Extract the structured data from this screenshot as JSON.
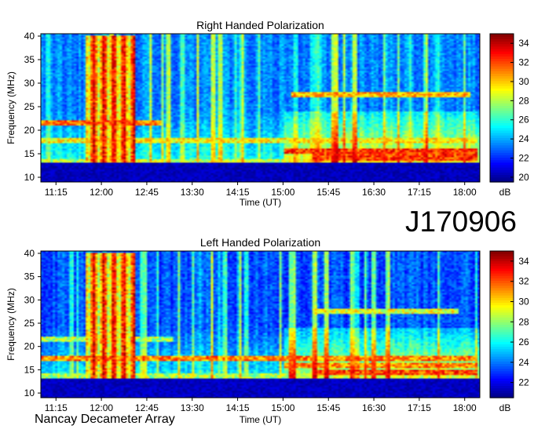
{
  "figure": {
    "date_id": "J170906",
    "instrument": "Nancay Decameter Array"
  },
  "chart_data": [
    {
      "type": "heatmap",
      "title": "Right Handed Polarization",
      "xlabel": "Time (UT)",
      "ylabel": "Frequency (MHz)",
      "xticks": [
        "11:15",
        "12:00",
        "12:45",
        "13:30",
        "14:15",
        "15:00",
        "15:45",
        "16:30",
        "17:15",
        "18:00"
      ],
      "xlim_hours": [
        11.0,
        18.25
      ],
      "yticks": [
        10,
        15,
        20,
        25,
        30,
        35,
        40
      ],
      "ylim": [
        9,
        40.5
      ],
      "colorbar": {
        "label": "dB",
        "ticks": [
          20,
          22,
          24,
          26,
          28,
          30,
          32,
          34
        ],
        "range": [
          19.5,
          35
        ],
        "colormap": "jet"
      },
      "features": {
        "bursts": [
          {
            "t0": 11.75,
            "t1": 12.55,
            "f0": 13,
            "f1": 40,
            "level": 35
          }
        ],
        "bands": [
          {
            "f": 27.5,
            "t0": 15.15,
            "t1": 18.1,
            "level": 32
          },
          {
            "f": 21.5,
            "t0": 11.0,
            "t1": 13.0,
            "level": 33
          },
          {
            "f": 17.8,
            "t0": 11.0,
            "t1": 18.2,
            "level": 31
          },
          {
            "f": 15.5,
            "t0": 15.0,
            "t1": 18.2,
            "level": 34
          },
          {
            "f": 14.2,
            "t0": 15.5,
            "t1": 18.2,
            "level": 34
          },
          {
            "f": 13.3,
            "t0": 11.0,
            "t1": 18.2,
            "level": 30
          }
        ],
        "floor_below_mhz": 13,
        "low_noise_level": 21.5
      }
    },
    {
      "type": "heatmap",
      "title": "Left Handed Polarization",
      "xlabel": "Time (UT)",
      "ylabel": "Frequency (MHz)",
      "xticks": [
        "11:15",
        "12:00",
        "12:45",
        "13:30",
        "14:15",
        "15:00",
        "15:45",
        "16:30",
        "17:15",
        "18:00"
      ],
      "xlim_hours": [
        11.0,
        18.25
      ],
      "yticks": [
        10,
        15,
        20,
        25,
        30,
        35,
        40
      ],
      "ylim": [
        9,
        40.5
      ],
      "colorbar": {
        "label": "dB",
        "ticks": [
          22,
          24,
          26,
          28,
          30,
          32,
          34
        ],
        "range": [
          20.5,
          35
        ],
        "colormap": "jet"
      },
      "features": {
        "bursts": [
          {
            "t0": 11.75,
            "t1": 12.55,
            "f0": 13,
            "f1": 40,
            "level": 35
          }
        ],
        "bands": [
          {
            "f": 27.5,
            "t0": 15.5,
            "t1": 17.9,
            "level": 31
          },
          {
            "f": 21.5,
            "t0": 11.0,
            "t1": 13.2,
            "level": 30
          },
          {
            "f": 17.5,
            "t0": 11.0,
            "t1": 18.2,
            "level": 33
          },
          {
            "f": 16.0,
            "t0": 15.0,
            "t1": 18.2,
            "level": 33
          },
          {
            "f": 14.5,
            "t0": 15.5,
            "t1": 18.2,
            "level": 34
          },
          {
            "f": 13.5,
            "t0": 11.0,
            "t1": 15.0,
            "level": 30
          }
        ],
        "floor_below_mhz": 13,
        "low_noise_level": 22
      }
    }
  ]
}
